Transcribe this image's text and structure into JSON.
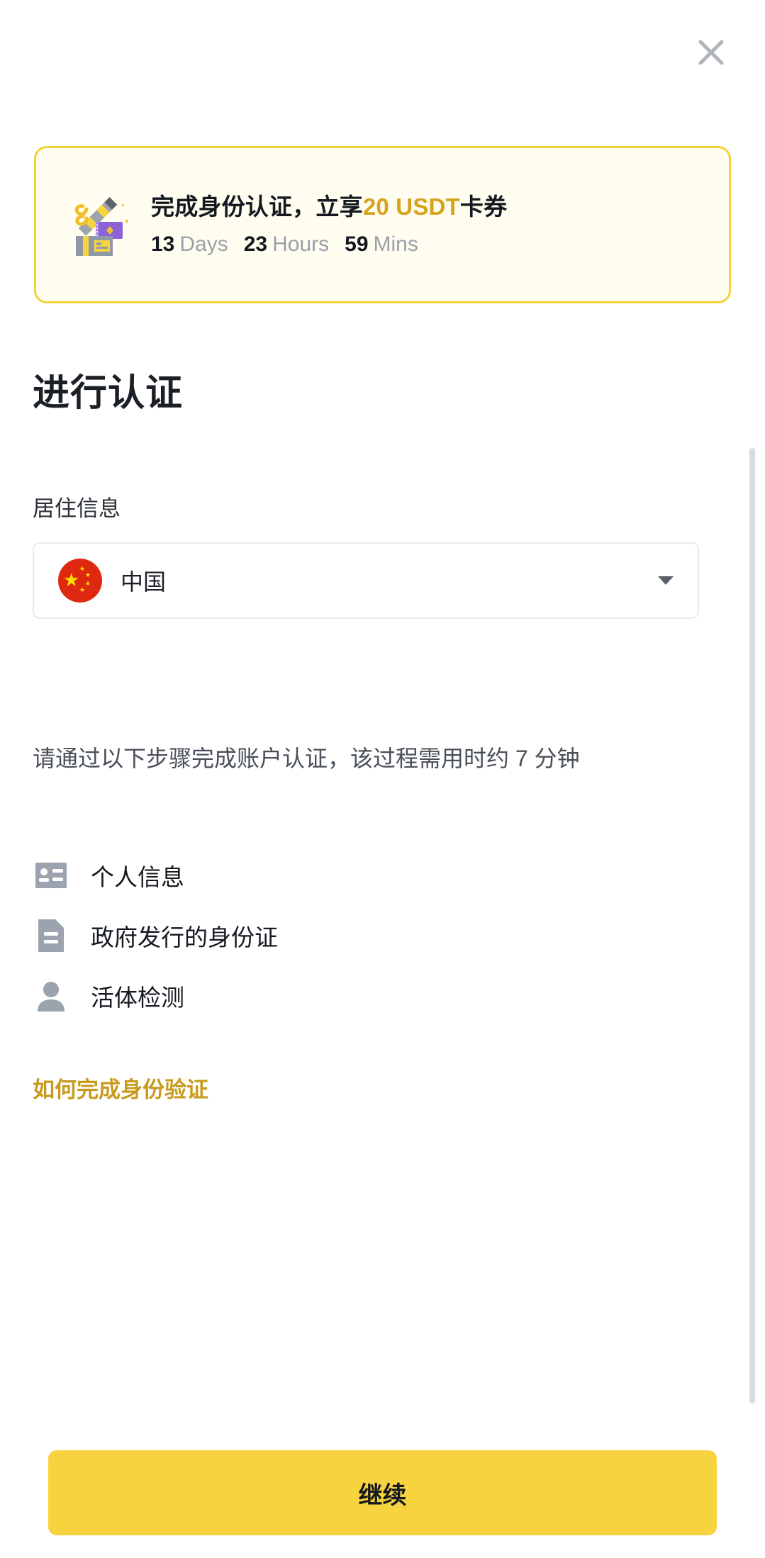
{
  "header": {
    "close_icon": "close-icon"
  },
  "promo": {
    "icon": "gift-coupon-icon",
    "title_prefix": "完成身份认证，立享",
    "title_accent": "20 USDT",
    "title_suffix": "卡券",
    "countdown": {
      "days_value": "13",
      "days_unit": "Days",
      "hours_value": "23",
      "hours_unit": "Hours",
      "mins_value": "59",
      "mins_unit": "Mins"
    },
    "border_color": "#f5d13c",
    "background_color": "#fffdf0",
    "accent_color": "#d6a41b"
  },
  "main": {
    "page_title": "进行认证",
    "section_label": "居住信息",
    "country": {
      "flag_icon": "china-flag-icon",
      "name": "中国",
      "chevron_icon": "chevron-down-icon"
    },
    "description": "请通过以下步骤完成账户认证，该过程需用时约 7 分钟",
    "steps": [
      {
        "icon": "id-card-icon",
        "label": "个人信息"
      },
      {
        "icon": "document-icon",
        "label": "政府发行的身份证"
      },
      {
        "icon": "person-icon",
        "label": "活体检测"
      }
    ],
    "help_link": "如何完成身份验证",
    "help_link_color": "#c79a1e"
  },
  "footer": {
    "continue_label": "继续",
    "continue_color": "#f7d33f"
  }
}
